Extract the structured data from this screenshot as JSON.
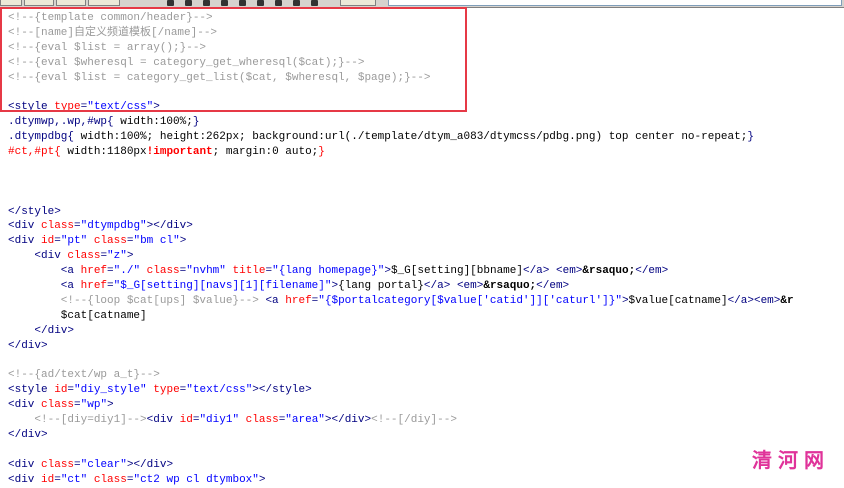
{
  "editor": {
    "lines": [
      [
        {
          "c": "c",
          "t": "<!--{template common/header}-->"
        }
      ],
      [
        {
          "c": "c",
          "t": "<!--[name]自定义频道模板[/name]-->"
        }
      ],
      [
        {
          "c": "c",
          "t": "<!--{eval $list = array();}-->"
        }
      ],
      [
        {
          "c": "c",
          "t": "<!--{eval $wheresql = category_get_wheresql($cat);}-->"
        }
      ],
      [
        {
          "c": "c",
          "t": "<!--{eval $list = category_get_list($cat, $wheresql, $page);}-->"
        }
      ],
      [],
      [
        {
          "c": "t",
          "t": "<style "
        },
        {
          "c": "a",
          "t": "type"
        },
        {
          "c": "t",
          "t": "="
        },
        {
          "c": "v",
          "t": "\"text/css\""
        },
        {
          "c": "t",
          "t": ">"
        }
      ],
      [
        {
          "c": "sel",
          "t": ".dtymwp,.wp,#wp{ "
        },
        {
          "c": "tx",
          "t": "width:100%;"
        },
        {
          "c": "sel",
          "t": "}"
        }
      ],
      [
        {
          "c": "sel",
          "t": ".dtympdbg{ "
        },
        {
          "c": "tx",
          "t": "width:100%; height:262px; background:url(./template/dtym_a083/dtymcss/pdbg.png) top center no-repeat;"
        },
        {
          "c": "sel",
          "t": "}"
        }
      ],
      [
        {
          "c": "a",
          "t": "#ct,#pt{ "
        },
        {
          "c": "tx",
          "t": "width:1180px"
        },
        {
          "c": "imp",
          "t": "!important"
        },
        {
          "c": "tx",
          "t": "; margin:0 auto;"
        },
        {
          "c": "a",
          "t": "}"
        }
      ],
      [],
      [],
      [],
      [
        {
          "c": "t",
          "t": "</style>"
        }
      ],
      [
        {
          "c": "t",
          "t": "<div "
        },
        {
          "c": "a",
          "t": "class"
        },
        {
          "c": "t",
          "t": "="
        },
        {
          "c": "v",
          "t": "\"dtympdbg\""
        },
        {
          "c": "t",
          "t": "></div>"
        }
      ],
      [
        {
          "c": "t",
          "t": "<div "
        },
        {
          "c": "a",
          "t": "id"
        },
        {
          "c": "t",
          "t": "="
        },
        {
          "c": "v",
          "t": "\"pt\""
        },
        {
          "c": "t",
          "t": " "
        },
        {
          "c": "a",
          "t": "class"
        },
        {
          "c": "t",
          "t": "="
        },
        {
          "c": "v",
          "t": "\"bm cl\""
        },
        {
          "c": "t",
          "t": ">"
        }
      ],
      [
        {
          "c": "t",
          "t": "    <div "
        },
        {
          "c": "a",
          "t": "class"
        },
        {
          "c": "t",
          "t": "="
        },
        {
          "c": "v",
          "t": "\"z\""
        },
        {
          "c": "t",
          "t": ">"
        }
      ],
      [
        {
          "c": "t",
          "t": "        <a "
        },
        {
          "c": "a",
          "t": "href"
        },
        {
          "c": "t",
          "t": "="
        },
        {
          "c": "v",
          "t": "\"./\""
        },
        {
          "c": "t",
          "t": " "
        },
        {
          "c": "a",
          "t": "class"
        },
        {
          "c": "t",
          "t": "="
        },
        {
          "c": "v",
          "t": "\"nvhm\""
        },
        {
          "c": "t",
          "t": " "
        },
        {
          "c": "a",
          "t": "title"
        },
        {
          "c": "t",
          "t": "="
        },
        {
          "c": "v",
          "t": "\"{lang homepage}\""
        },
        {
          "c": "t",
          "t": ">"
        },
        {
          "c": "tx",
          "t": "$_G[setting][bbname]"
        },
        {
          "c": "t",
          "t": "</a>"
        },
        {
          "c": "tx",
          "t": " "
        },
        {
          "c": "t",
          "t": "<em>"
        },
        {
          "c": "b",
          "t": "&rsaquo;"
        },
        {
          "c": "t",
          "t": "</em>"
        }
      ],
      [
        {
          "c": "t",
          "t": "        <a "
        },
        {
          "c": "a",
          "t": "href"
        },
        {
          "c": "t",
          "t": "="
        },
        {
          "c": "v",
          "t": "\"$_G[setting][navs][1][filename]\""
        },
        {
          "c": "t",
          "t": ">"
        },
        {
          "c": "tx",
          "t": "{lang portal}"
        },
        {
          "c": "t",
          "t": "</a>"
        },
        {
          "c": "tx",
          "t": " "
        },
        {
          "c": "t",
          "t": "<em>"
        },
        {
          "c": "b",
          "t": "&rsaquo;"
        },
        {
          "c": "t",
          "t": "</em>"
        }
      ],
      [
        {
          "c": "c",
          "t": "        <!--{loop $cat[ups] $value}-->"
        },
        {
          "c": "tx",
          "t": " "
        },
        {
          "c": "t",
          "t": "<a "
        },
        {
          "c": "a",
          "t": "href"
        },
        {
          "c": "t",
          "t": "="
        },
        {
          "c": "v",
          "t": "\"{$portalcategory[$value['catid']]['caturl']}\""
        },
        {
          "c": "t",
          "t": ">"
        },
        {
          "c": "tx",
          "t": "$value[catname]"
        },
        {
          "c": "t",
          "t": "</a><em>"
        },
        {
          "c": "b",
          "t": "&r"
        }
      ],
      [
        {
          "c": "tx",
          "t": "        $cat[catname]"
        }
      ],
      [
        {
          "c": "t",
          "t": "    </div>"
        }
      ],
      [
        {
          "c": "t",
          "t": "</div>"
        }
      ],
      [],
      [
        {
          "c": "c",
          "t": "<!--{ad/text/wp a_t}-->"
        }
      ],
      [
        {
          "c": "t",
          "t": "<style "
        },
        {
          "c": "a",
          "t": "id"
        },
        {
          "c": "t",
          "t": "="
        },
        {
          "c": "v",
          "t": "\"diy_style\""
        },
        {
          "c": "t",
          "t": " "
        },
        {
          "c": "a",
          "t": "type"
        },
        {
          "c": "t",
          "t": "="
        },
        {
          "c": "v",
          "t": "\"text/css\""
        },
        {
          "c": "t",
          "t": "></style>"
        }
      ],
      [
        {
          "c": "t",
          "t": "<div "
        },
        {
          "c": "a",
          "t": "class"
        },
        {
          "c": "t",
          "t": "="
        },
        {
          "c": "v",
          "t": "\"wp\""
        },
        {
          "c": "t",
          "t": ">"
        }
      ],
      [
        {
          "c": "c",
          "t": "    <!--[diy=diy1]-->"
        },
        {
          "c": "t",
          "t": "<div "
        },
        {
          "c": "a",
          "t": "id"
        },
        {
          "c": "t",
          "t": "="
        },
        {
          "c": "v",
          "t": "\"diy1\""
        },
        {
          "c": "t",
          "t": " "
        },
        {
          "c": "a",
          "t": "class"
        },
        {
          "c": "t",
          "t": "="
        },
        {
          "c": "v",
          "t": "\"area\""
        },
        {
          "c": "t",
          "t": "></div>"
        },
        {
          "c": "c",
          "t": "<!--[/diy]-->"
        }
      ],
      [
        {
          "c": "t",
          "t": "</div>"
        }
      ],
      [],
      [
        {
          "c": "t",
          "t": "<div "
        },
        {
          "c": "a",
          "t": "class"
        },
        {
          "c": "t",
          "t": "="
        },
        {
          "c": "v",
          "t": "\"clear\""
        },
        {
          "c": "t",
          "t": "></div>"
        }
      ],
      [
        {
          "c": "t",
          "t": "<div "
        },
        {
          "c": "a",
          "t": "id"
        },
        {
          "c": "t",
          "t": "="
        },
        {
          "c": "v",
          "t": "\"ct\""
        },
        {
          "c": "t",
          "t": " "
        },
        {
          "c": "a",
          "t": "class"
        },
        {
          "c": "t",
          "t": "="
        },
        {
          "c": "v",
          "t": "\"ct2 wp cl dtymbox\""
        },
        {
          "c": "t",
          "t": ">"
        }
      ]
    ]
  },
  "watermark": "清河网",
  "colors": {
    "highlight": "#e63946",
    "watermark": "#e0339a",
    "comment": "#9a9a9a",
    "tag": "#000080",
    "attr": "#ff0000",
    "value": "#0000ff"
  }
}
